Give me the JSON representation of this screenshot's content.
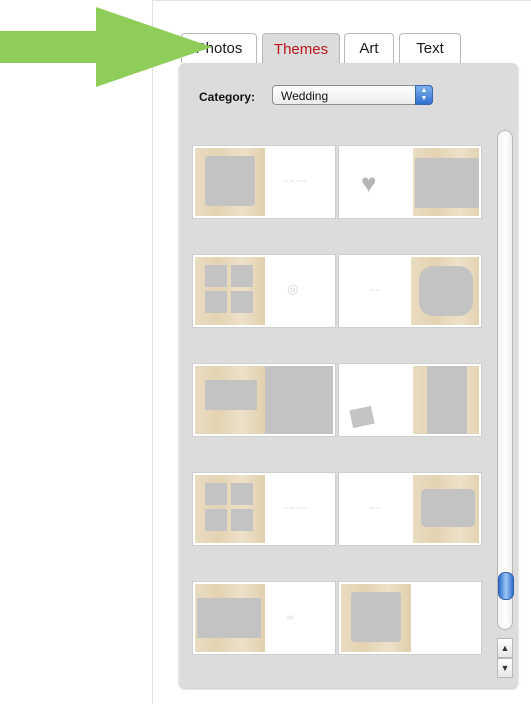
{
  "tabs": [
    {
      "label": "Photos",
      "active": false
    },
    {
      "label": "Themes",
      "active": true
    },
    {
      "label": "Art",
      "active": false
    },
    {
      "label": "Text",
      "active": false
    }
  ],
  "category": {
    "label": "Category:",
    "selected": "Wedding"
  },
  "colors": {
    "active_tab_text": "#c0141c",
    "panel_bg": "#dcdcdc",
    "arrow_green": "#8fcd5a",
    "scroll_thumb": "#2f6fd0"
  },
  "icons": {
    "pointer_arrow": "green-arrow-icon",
    "select_arrows": "up-down-arrows-icon",
    "scroll_up": "scroll-up-icon",
    "scroll_down": "scroll-down-icon"
  }
}
